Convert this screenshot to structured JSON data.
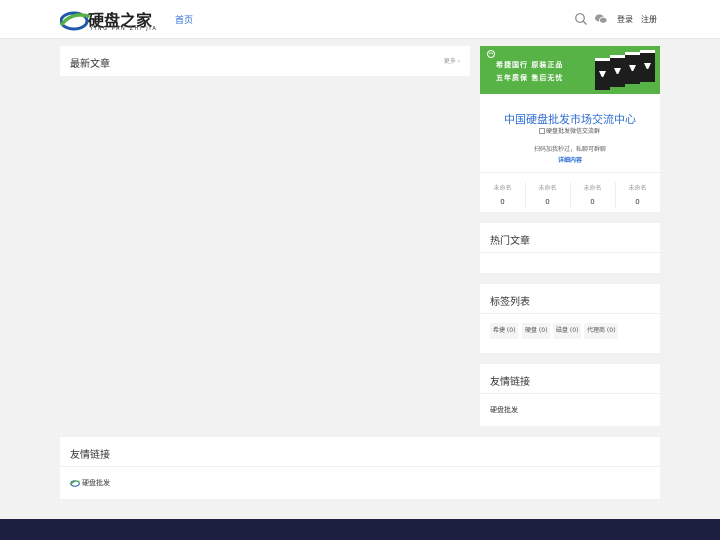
{
  "header": {
    "logo_text": "硬盘之家",
    "logo_sub": "YING PAN ZHI JIA",
    "nav_home": "首页",
    "login": "登录",
    "register": "注册",
    "icons": [
      "search-icon",
      "wechat-icon"
    ]
  },
  "latest": {
    "title": "最新文章",
    "more": "更多 ›"
  },
  "banner": {
    "line1": "希捷国行  原装正品",
    "line2": "五年质保  售后无忧"
  },
  "promo": {
    "title": "中国硬盘批发市场交流中心",
    "image_alt": "硬盘批发微信交流群",
    "line": "扫码加我秒过，私聊可群聊",
    "detail": "详细内容"
  },
  "stats": [
    {
      "label": "未命名",
      "value": "0"
    },
    {
      "label": "未命名",
      "value": "0"
    },
    {
      "label": "未命名",
      "value": "0"
    },
    {
      "label": "未命名",
      "value": "0"
    }
  ],
  "hot": {
    "title": "热门文章"
  },
  "tags": {
    "title": "标签列表",
    "items": [
      "希捷 (0)",
      "硬盘 (0)",
      "磁盘 (0)",
      "代理商 (0)"
    ]
  },
  "friend_side": {
    "title": "友情链接",
    "items": [
      "硬盘批发"
    ]
  },
  "friend_bottom": {
    "title": "友情链接",
    "items": [
      "硬盘批发"
    ]
  },
  "colors": {
    "accent": "#2d6dd2",
    "banner_green": "#58b347",
    "footer": "#1c1f3f"
  }
}
